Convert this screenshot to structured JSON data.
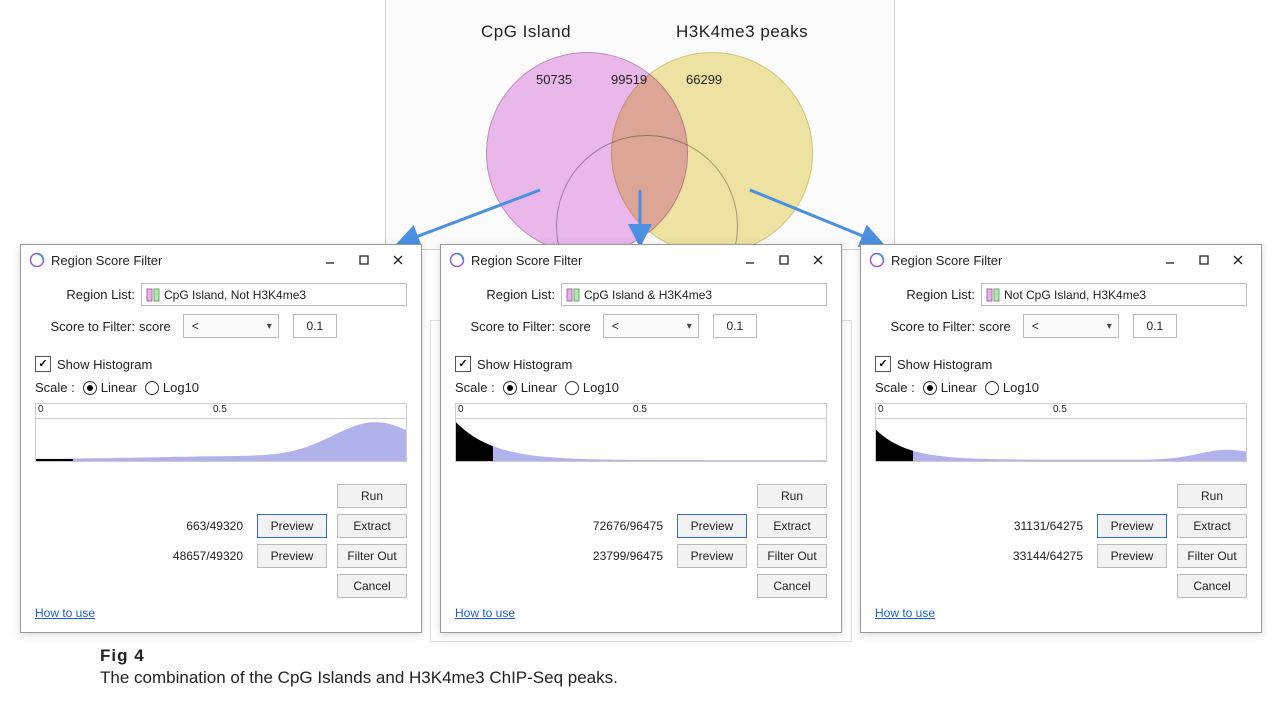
{
  "venn": {
    "labelA": "CpG Island",
    "labelB": "H3K4me3 peaks",
    "countA_only": "50735",
    "countAB": "99519",
    "countB_only": "66299"
  },
  "dlg": {
    "title": "Region Score Filter",
    "regionListLabel": "Region List:",
    "scoreToFilterLabel": "Score to Filter:",
    "scoreFieldName": "score",
    "op": "<",
    "threshold": "0.1",
    "showHistLabel": "Show Histogram",
    "scaleLabel": "Scale :",
    "scaleLinear": "Linear",
    "scaleLog10": "Log10",
    "axisTick0": "0",
    "axisTick5": "0.5",
    "runLabel": "Run",
    "previewLabel": "Preview",
    "extractLabel": "Extract",
    "filterOutLabel": "Filter Out",
    "cancelLabel": "Cancel",
    "howToUseLabel": "How to use"
  },
  "windows": [
    {
      "regionList": "CpG Island, Not H3K4me3",
      "count1": "663/49320",
      "count2": "48657/49320",
      "shape": "right"
    },
    {
      "regionList": "CpG Island & H3K4me3",
      "count1": "72676/96475",
      "count2": "23799/96475",
      "shape": "left"
    },
    {
      "regionList": "Not CpG Island, H3K4me3",
      "count1": "31131/64275",
      "count2": "33144/64275",
      "shape": "bimodal"
    }
  ],
  "caption": {
    "title": "Fig 4",
    "text": "The combination of the CpG Islands and H3K4me3 ChIP-Seq peaks."
  }
}
